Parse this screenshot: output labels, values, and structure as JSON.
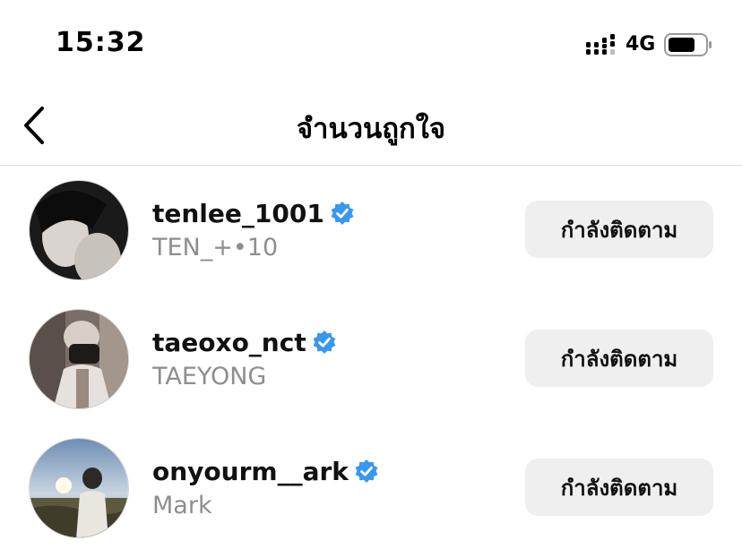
{
  "status_bar": {
    "time": "15:32",
    "network": "4G",
    "signal_icon": "signal-strength-icon",
    "battery_icon": "battery-icon"
  },
  "header": {
    "title": "จำนวนถูกใจ",
    "back_icon": "chevron-left-icon"
  },
  "users": [
    {
      "username": "tenlee_1001",
      "full_name": "TEN_+•10",
      "verified": true,
      "button_label": "กำลังติดตาม"
    },
    {
      "username": "taeoxo_nct",
      "full_name": "TAEYONG",
      "verified": true,
      "button_label": "กำลังติดตาม"
    },
    {
      "username": "onyourm__ark",
      "full_name": "Mark",
      "verified": true,
      "button_label": "กำลังติดตาม"
    }
  ],
  "colors": {
    "verified_blue": "#3897f0",
    "secondary_text": "#8e8e8e",
    "button_bg": "#efefef",
    "divider": "#dbdbdb"
  }
}
